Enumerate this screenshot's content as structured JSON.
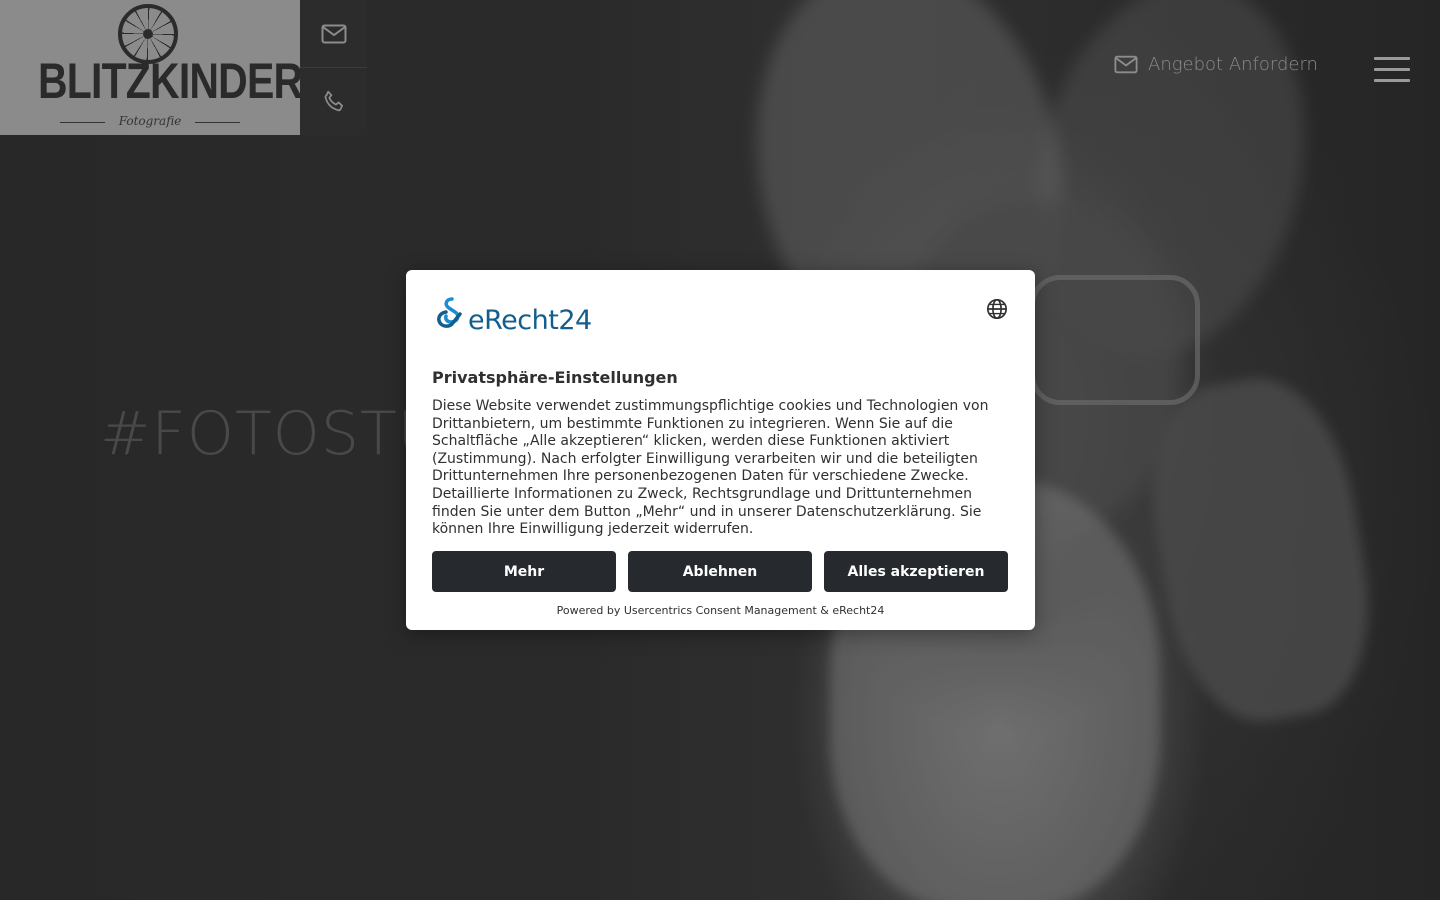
{
  "brand": {
    "name": "BLITZKINDER",
    "subtitle": "Fotografie"
  },
  "contact": {
    "email_icon": "envelope-icon",
    "phone_icon": "phone-icon"
  },
  "header": {
    "offer_label": "Angebot Anfordern",
    "menu_icon": "hamburger-icon"
  },
  "hero": {
    "heading": "#FOTOSTU"
  },
  "consent": {
    "provider_logo": "eRecht24",
    "language_icon": "globe-icon",
    "title": "Privatsphäre-Einstellungen",
    "body": "Diese Website verwendet zustimmungspflichtige cookies und Technologien von Drittanbietern, um bestimmte Funktionen zu integrieren. Wenn Sie auf die Schaltfläche „Alle akzeptieren“ klicken, werden diese Funktionen aktiviert (Zustimmung). Nach erfolgter Einwilligung verarbeiten wir und die beteiligten Drittunternehmen Ihre personenbezogenen Daten für verschiedene Zwecke. Detaillierte Informationen zu Zweck, Rechtsgrundlage und Drittunternehmen finden Sie unter dem Button „Mehr“ und in unserer Datenschutzerklärung. Sie können Ihre Einwilligung jederzeit widerrufen.",
    "buttons": {
      "more": "Mehr",
      "decline": "Ablehnen",
      "accept_all": "Alles akzeptieren"
    },
    "footer": "Powered by Usercentrics Consent Management & eRecht24"
  },
  "colors": {
    "logo_bg": "#8b8b8b",
    "modal_button": "#262a2e",
    "erecht_blue": "#135e8c"
  }
}
